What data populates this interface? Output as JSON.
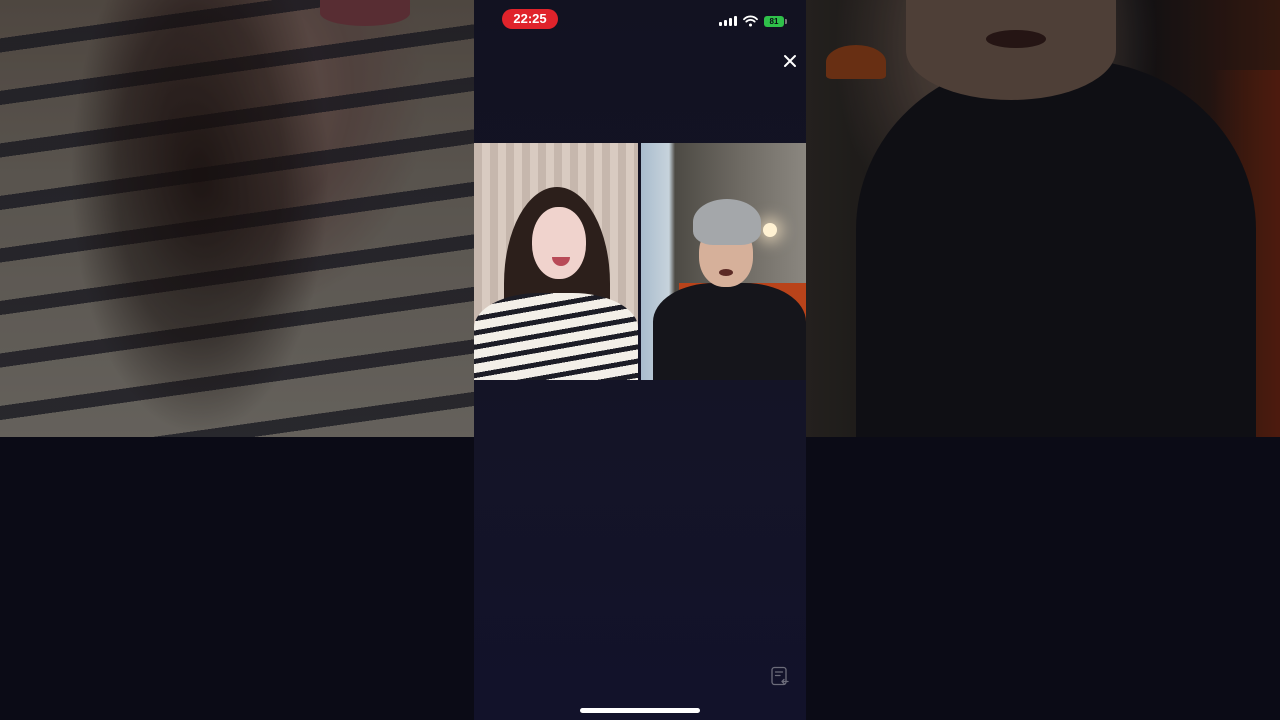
{
  "status_bar": {
    "time": "22:25",
    "battery": "81"
  },
  "icons": {
    "close": "close-icon",
    "signal": "cellular-signal-icon",
    "wifi": "wifi-icon",
    "battery": "battery-icon",
    "notes": "notes-icon"
  },
  "colors": {
    "time_pill": "#e0232b",
    "battery": "#2fc14a",
    "background": "#12122a"
  }
}
